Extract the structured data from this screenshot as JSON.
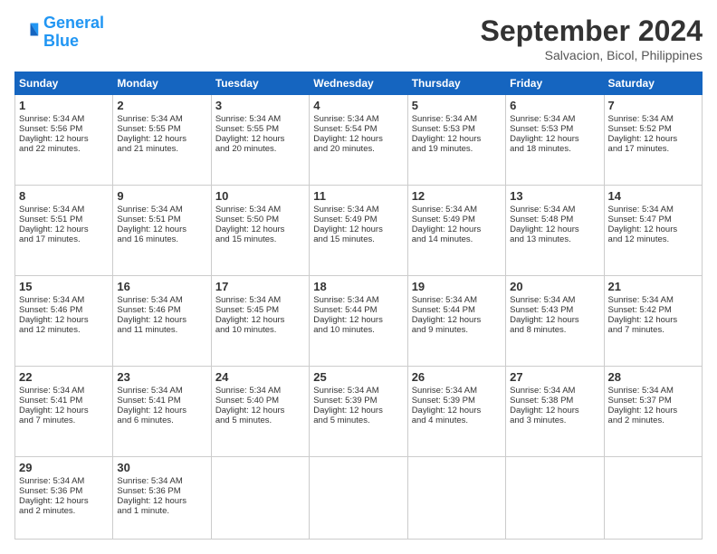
{
  "logo": {
    "line1": "General",
    "line2": "Blue"
  },
  "title": "September 2024",
  "location": "Salvacion, Bicol, Philippines",
  "headers": [
    "Sunday",
    "Monday",
    "Tuesday",
    "Wednesday",
    "Thursday",
    "Friday",
    "Saturday"
  ],
  "weeks": [
    [
      {
        "day": "1",
        "sunrise": "5:34 AM",
        "sunset": "5:56 PM",
        "daylight": "12 hours and 22 minutes."
      },
      {
        "day": "2",
        "sunrise": "5:34 AM",
        "sunset": "5:55 PM",
        "daylight": "12 hours and 21 minutes."
      },
      {
        "day": "3",
        "sunrise": "5:34 AM",
        "sunset": "5:55 PM",
        "daylight": "12 hours and 20 minutes."
      },
      {
        "day": "4",
        "sunrise": "5:34 AM",
        "sunset": "5:54 PM",
        "daylight": "12 hours and 20 minutes."
      },
      {
        "day": "5",
        "sunrise": "5:34 AM",
        "sunset": "5:53 PM",
        "daylight": "12 hours and 19 minutes."
      },
      {
        "day": "6",
        "sunrise": "5:34 AM",
        "sunset": "5:53 PM",
        "daylight": "12 hours and 18 minutes."
      },
      {
        "day": "7",
        "sunrise": "5:34 AM",
        "sunset": "5:52 PM",
        "daylight": "12 hours and 17 minutes."
      }
    ],
    [
      {
        "day": "8",
        "sunrise": "5:34 AM",
        "sunset": "5:51 PM",
        "daylight": "12 hours and 17 minutes."
      },
      {
        "day": "9",
        "sunrise": "5:34 AM",
        "sunset": "5:51 PM",
        "daylight": "12 hours and 16 minutes."
      },
      {
        "day": "10",
        "sunrise": "5:34 AM",
        "sunset": "5:50 PM",
        "daylight": "12 hours and 15 minutes."
      },
      {
        "day": "11",
        "sunrise": "5:34 AM",
        "sunset": "5:49 PM",
        "daylight": "12 hours and 15 minutes."
      },
      {
        "day": "12",
        "sunrise": "5:34 AM",
        "sunset": "5:49 PM",
        "daylight": "12 hours and 14 minutes."
      },
      {
        "day": "13",
        "sunrise": "5:34 AM",
        "sunset": "5:48 PM",
        "daylight": "12 hours and 13 minutes."
      },
      {
        "day": "14",
        "sunrise": "5:34 AM",
        "sunset": "5:47 PM",
        "daylight": "12 hours and 12 minutes."
      }
    ],
    [
      {
        "day": "15",
        "sunrise": "5:34 AM",
        "sunset": "5:46 PM",
        "daylight": "12 hours and 12 minutes."
      },
      {
        "day": "16",
        "sunrise": "5:34 AM",
        "sunset": "5:46 PM",
        "daylight": "12 hours and 11 minutes."
      },
      {
        "day": "17",
        "sunrise": "5:34 AM",
        "sunset": "5:45 PM",
        "daylight": "12 hours and 10 minutes."
      },
      {
        "day": "18",
        "sunrise": "5:34 AM",
        "sunset": "5:44 PM",
        "daylight": "12 hours and 10 minutes."
      },
      {
        "day": "19",
        "sunrise": "5:34 AM",
        "sunset": "5:44 PM",
        "daylight": "12 hours and 9 minutes."
      },
      {
        "day": "20",
        "sunrise": "5:34 AM",
        "sunset": "5:43 PM",
        "daylight": "12 hours and 8 minutes."
      },
      {
        "day": "21",
        "sunrise": "5:34 AM",
        "sunset": "5:42 PM",
        "daylight": "12 hours and 7 minutes."
      }
    ],
    [
      {
        "day": "22",
        "sunrise": "5:34 AM",
        "sunset": "5:41 PM",
        "daylight": "12 hours and 7 minutes."
      },
      {
        "day": "23",
        "sunrise": "5:34 AM",
        "sunset": "5:41 PM",
        "daylight": "12 hours and 6 minutes."
      },
      {
        "day": "24",
        "sunrise": "5:34 AM",
        "sunset": "5:40 PM",
        "daylight": "12 hours and 5 minutes."
      },
      {
        "day": "25",
        "sunrise": "5:34 AM",
        "sunset": "5:39 PM",
        "daylight": "12 hours and 5 minutes."
      },
      {
        "day": "26",
        "sunrise": "5:34 AM",
        "sunset": "5:39 PM",
        "daylight": "12 hours and 4 minutes."
      },
      {
        "day": "27",
        "sunrise": "5:34 AM",
        "sunset": "5:38 PM",
        "daylight": "12 hours and 3 minutes."
      },
      {
        "day": "28",
        "sunrise": "5:34 AM",
        "sunset": "5:37 PM",
        "daylight": "12 hours and 2 minutes."
      }
    ],
    [
      {
        "day": "29",
        "sunrise": "5:34 AM",
        "sunset": "5:36 PM",
        "daylight": "12 hours and 2 minutes."
      },
      {
        "day": "30",
        "sunrise": "5:34 AM",
        "sunset": "5:36 PM",
        "daylight": "12 hours and 1 minute."
      },
      null,
      null,
      null,
      null,
      null
    ]
  ]
}
